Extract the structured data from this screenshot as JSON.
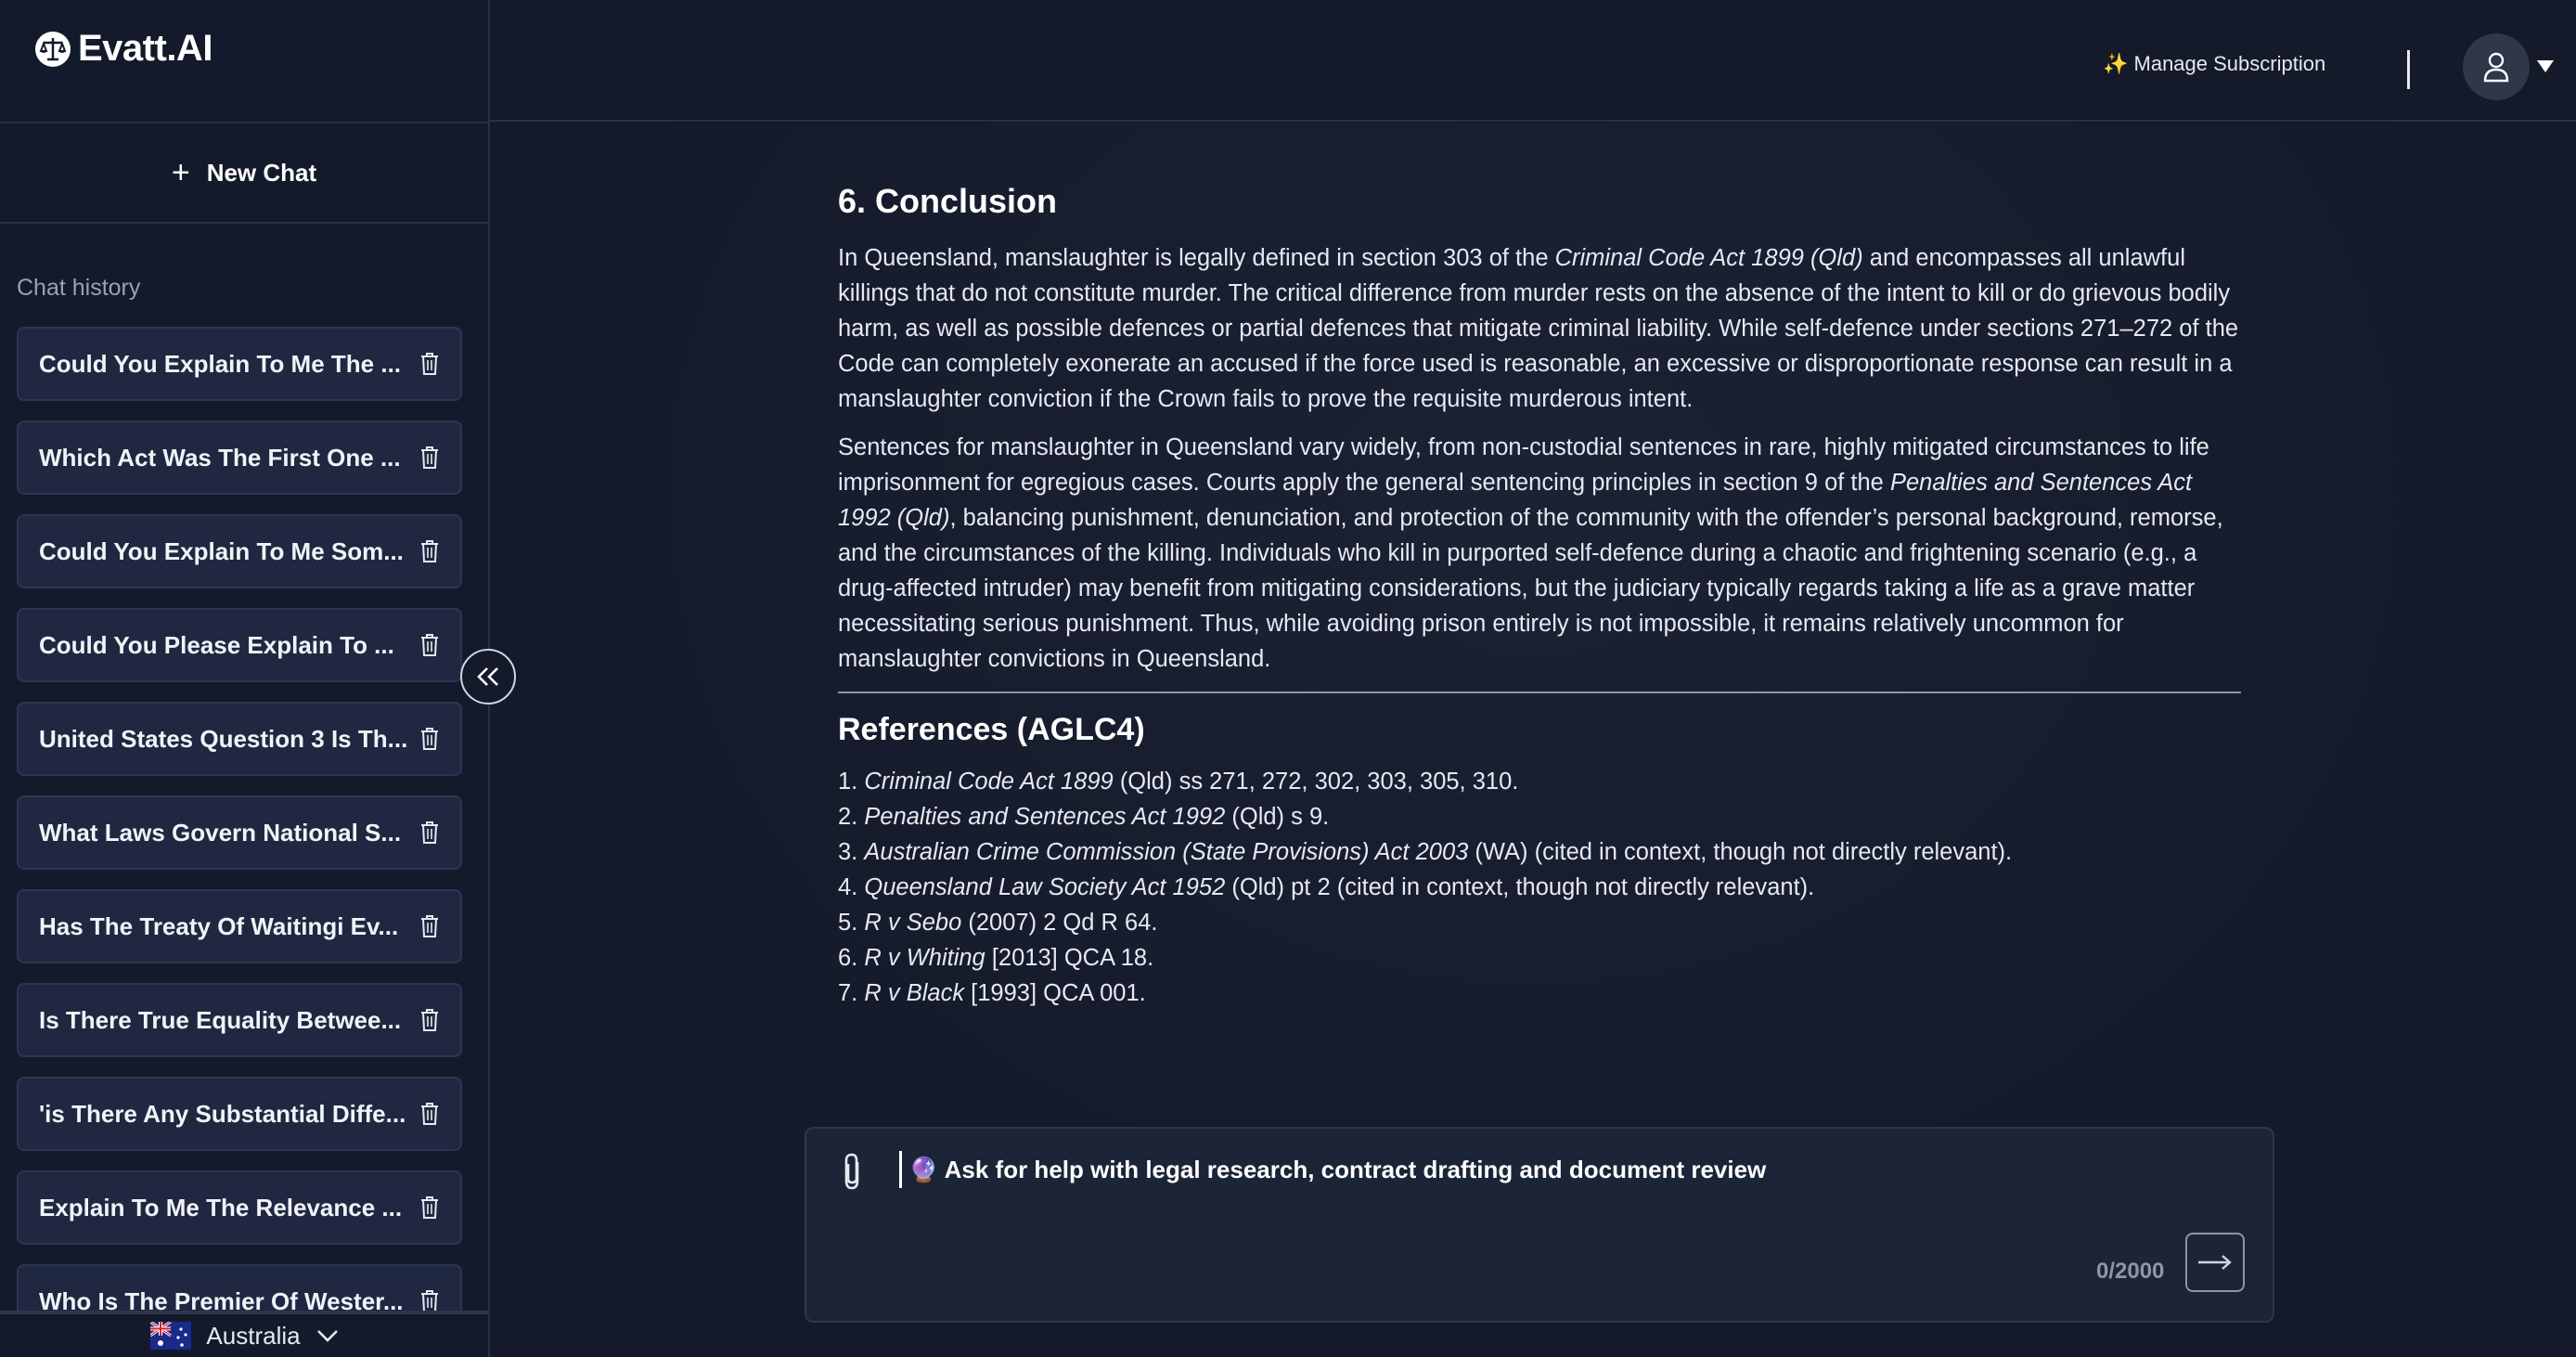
{
  "brand": {
    "name": "Evatt.AI"
  },
  "sidebar": {
    "new_chat_label": "New Chat",
    "history_title": "Chat history",
    "chats": [
      "Could You Explain To Me The ...",
      "Which Act Was The First One ...",
      "Could You Explain To Me Som...",
      "Could You Please Explain To ...",
      "United States Question 3 Is Th...",
      "What Laws Govern National S...",
      "Has The Treaty Of Waitingi Ev...",
      "Is There True Equality Betwee...",
      "'is There Any Substantial Diffe...",
      "Explain To Me The Relevance ...",
      "Who Is The Premier Of Wester..."
    ],
    "region": "Australia"
  },
  "header": {
    "manage_subscription": "✨ Manage Subscription"
  },
  "content": {
    "conclusion_heading": "6. Conclusion",
    "p1": {
      "a": "In Queensland, manslaughter is legally defined in section 303 of the ",
      "b": "Criminal Code Act 1899 (Qld)",
      "c": " and encompasses all unlawful killings that do not constitute murder. The critical difference from murder rests on the absence of the intent to kill or do grievous bodily harm, as well as possible defences or partial defences that mitigate criminal liability. While self-defence under sections 271–272 of the Code can completely exonerate an accused if the force used is reasonable, an excessive or disproportionate response can result in a manslaughter conviction if the Crown fails to prove the requisite murderous intent."
    },
    "p2": {
      "a": "Sentences for manslaughter in Queensland vary widely, from non-custodial sentences in rare, highly mitigated circumstances to life imprisonment for egregious cases. Courts apply the general sentencing principles in section 9 of the ",
      "b": "Penalties and Sentences Act 1992 (Qld)",
      "c": ", balancing punishment, denunciation, and protection of the community with the offender’s personal background, remorse, and the circumstances of the killing. Individuals who kill in purported self-defence during a chaotic and frightening scenario (e.g., a drug-affected intruder) may benefit from mitigating considerations, but the judiciary typically regards taking a life as a grave matter necessitating serious punishment. Thus, while avoiding prison entirely is not impossible, it remains relatively uncommon for manslaughter convictions in Queensland."
    },
    "references_heading": "References (AGLC4)",
    "references": [
      {
        "num": "1.",
        "title": "Criminal Code Act 1899",
        "rest": " (Qld) ss 271, 272, 302, 303, 305, 310."
      },
      {
        "num": "2.",
        "title": "Penalties and Sentences Act 1992",
        "rest": " (Qld) s 9."
      },
      {
        "num": "3.",
        "title": "Australian Crime Commission (State Provisions) Act 2003",
        "rest": " (WA) (cited in context, though not directly relevant)."
      },
      {
        "num": "4.",
        "title": "Queensland Law Society Act 1952",
        "rest": " (Qld) pt 2 (cited in context, though not directly relevant)."
      },
      {
        "num": "5.",
        "title": "R v Sebo",
        "rest": " (2007) 2 Qd R 64."
      },
      {
        "num": "6.",
        "title": "R v Whiting",
        "rest": " [2013] QCA 18."
      },
      {
        "num": "7.",
        "title": "R v Black",
        "rest": " [1993] QCA 001."
      }
    ]
  },
  "composer": {
    "placeholder": "🔮 Ask for help with legal research, contract drafting and document review",
    "counter": "0/2000"
  },
  "colors": {
    "background": "#141a2a",
    "sidebar": "#131a2b",
    "chat_item": "#1f2840",
    "text": "#e6e9f0",
    "muted": "#8d96a8"
  }
}
